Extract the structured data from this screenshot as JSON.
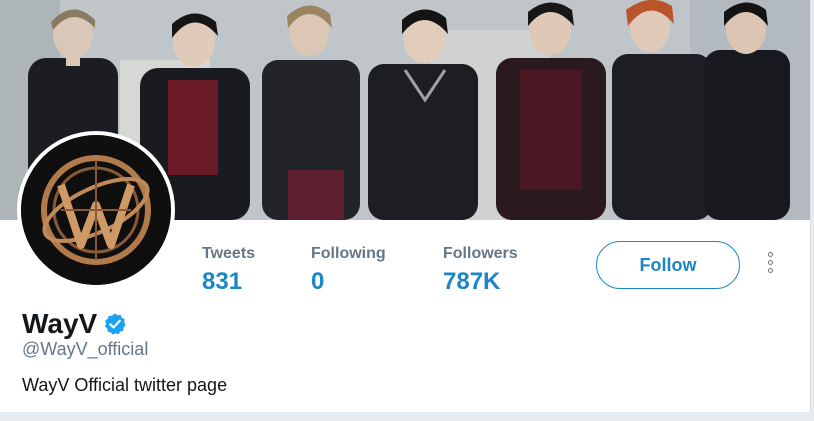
{
  "profile": {
    "display_name": "WayV",
    "handle": "@WayV_official",
    "bio": "WayV Official twitter page",
    "verified": true
  },
  "stats": [
    {
      "label": "Tweets",
      "value": "831"
    },
    {
      "label": "Following",
      "value": "0"
    },
    {
      "label": "Followers",
      "value": "787K"
    }
  ],
  "actions": {
    "follow_label": "Follow",
    "more_icon": "more-vertical-icon"
  },
  "colors": {
    "accent": "#1d86c4",
    "verified": "#1da1f2",
    "secondary_text": "#657786",
    "primary_text": "#14171a"
  },
  "images": {
    "banner": "group-photo-banner",
    "avatar": "wayv-logo-avatar"
  }
}
